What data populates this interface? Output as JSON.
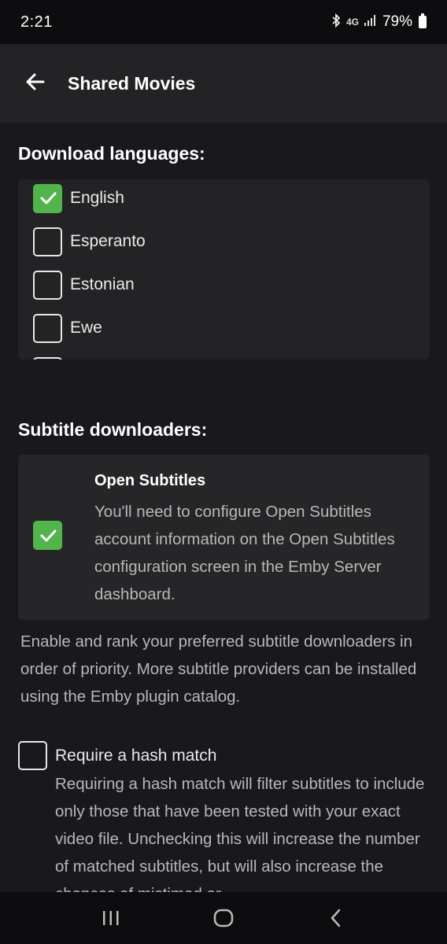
{
  "status_bar": {
    "time": "2:21",
    "network": "4G",
    "battery_percent": "79%",
    "icons": [
      "bluetooth-icon",
      "network-icon",
      "signal-icon",
      "battery-icon"
    ]
  },
  "app_bar": {
    "title": "Shared Movies",
    "back_icon": "arrow-left-icon"
  },
  "download_languages": {
    "heading": "Download languages:",
    "items": [
      {
        "label": "English",
        "checked": true
      },
      {
        "label": "Esperanto",
        "checked": false
      },
      {
        "label": "Estonian",
        "checked": false
      },
      {
        "label": "Ewe",
        "checked": false
      }
    ]
  },
  "subtitle_downloaders": {
    "heading": "Subtitle downloaders:",
    "providers": [
      {
        "name": "Open Subtitles",
        "description": "You'll need to configure Open Subtitles account information on the Open Subtitles configuration screen in the Emby Server dashboard.",
        "enabled": true
      }
    ],
    "help_text": "Enable and rank your preferred subtitle downloaders in order of priority. More subtitle providers can be installed using the Emby plugin catalog."
  },
  "hash_match": {
    "label": "Require a hash match",
    "checked": false,
    "description": "Requiring a hash match will filter subtitles to include only those that have been tested with your exact video file. Unchecking this will increase the number of matched subtitles, but will also increase the chances of mistimed or"
  },
  "colors": {
    "accent": "#52b54b",
    "background": "#19181c",
    "card": "#232326"
  },
  "nav_bar": {
    "icons": [
      "recents-icon",
      "home-icon",
      "back-icon"
    ]
  }
}
